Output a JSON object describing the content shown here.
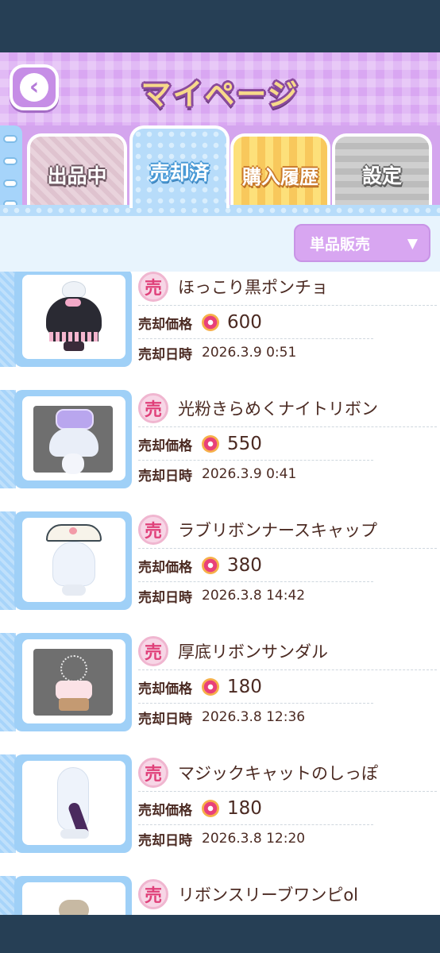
{
  "header": {
    "title": "マイページ",
    "back_icon": "back-arrow-icon"
  },
  "tabs": [
    {
      "label": "出品中",
      "active": false
    },
    {
      "label": "売却済",
      "active": true
    },
    {
      "label": "購入履歴",
      "active": false
    },
    {
      "label": "設定",
      "active": false
    }
  ],
  "filter": {
    "selected": "単品販売",
    "caret": "▼"
  },
  "labels": {
    "price": "売却価格",
    "date": "売却日時",
    "badge": "売"
  },
  "items": [
    {
      "name": "ほっこり黒ポンチョ",
      "price": "600",
      "date": "2026.3.9 0:51"
    },
    {
      "name": "光粉きらめくナイトリボン",
      "price": "550",
      "date": "2026.3.9 0:41"
    },
    {
      "name": "ラブリボンナースキャップ",
      "price": "380",
      "date": "2026.3.8 14:42"
    },
    {
      "name": "厚底リボンサンダル",
      "price": "180",
      "date": "2026.3.8 12:36"
    },
    {
      "name": "マジックキャットのしっぽ",
      "price": "180",
      "date": "2026.3.8 12:20"
    },
    {
      "name": "リボンスリーブワンピol",
      "price": "",
      "date": ""
    }
  ],
  "colors": {
    "header": "#d9a7f2",
    "accent_blue": "#9fd0f7",
    "text": "#4b2a22",
    "status_bar": "#263f55"
  }
}
